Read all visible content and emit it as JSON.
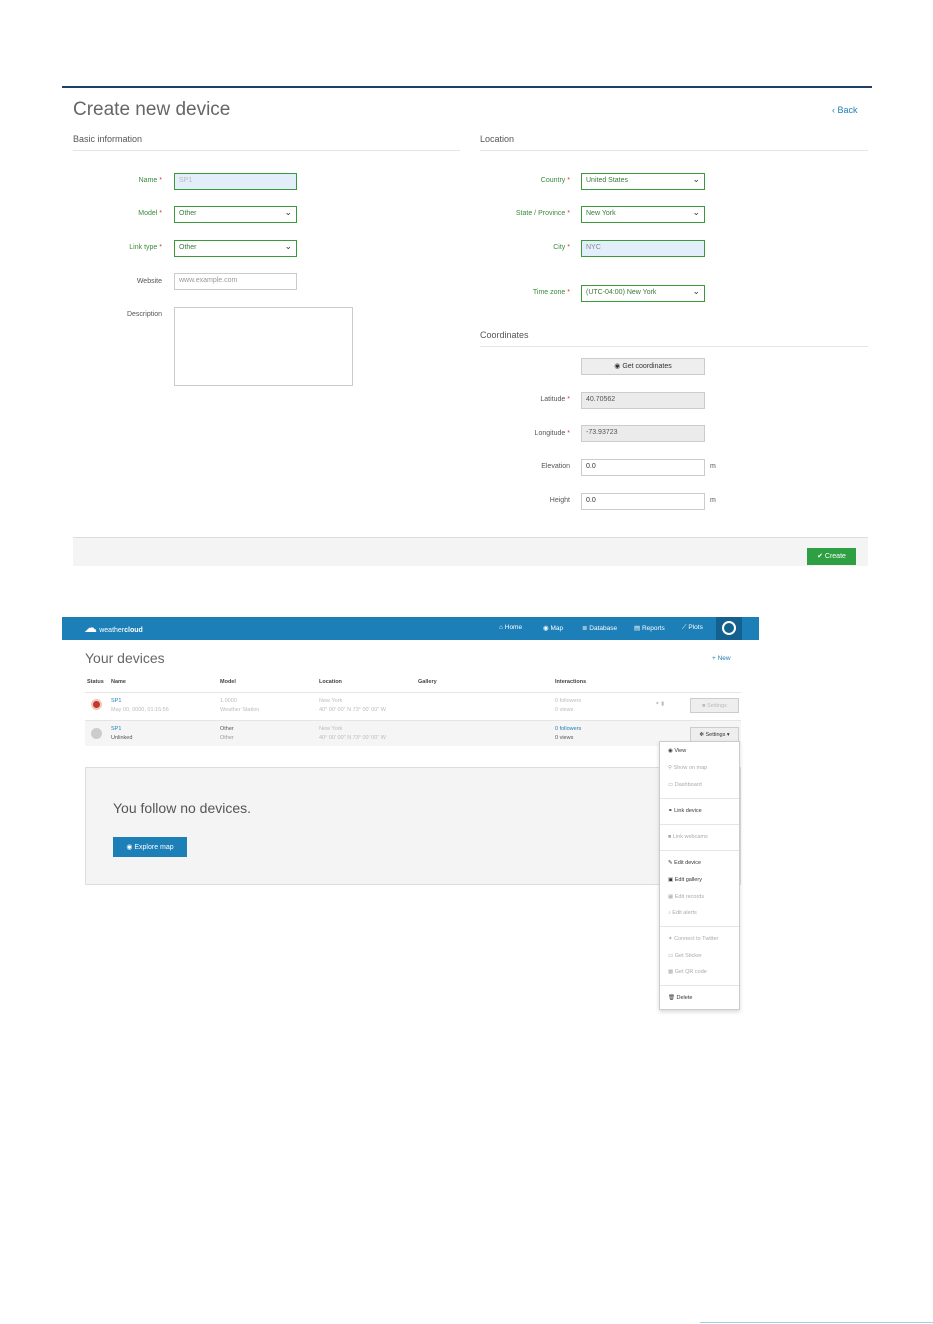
{
  "form": {
    "title": "Create new device",
    "back": "‹ Back",
    "basic_section": "Basic information",
    "location_section": "Location",
    "coordinates_section": "Coordinates",
    "name": {
      "label": "Name",
      "value": "SP1"
    },
    "model": {
      "label": "Model",
      "value": "Other"
    },
    "link_type": {
      "label": "Link type",
      "value": "Other"
    },
    "website": {
      "label": "Website",
      "placeholder": "www.example.com"
    },
    "description": {
      "label": "Description"
    },
    "country": {
      "label": "Country",
      "value": "United States"
    },
    "state": {
      "label": "State / Province",
      "value": "New York"
    },
    "city": {
      "label": "City",
      "value": "NYC"
    },
    "timezone": {
      "label": "Time zone",
      "value": "(UTC-04:00) New York"
    },
    "get_coordinates": "Get coordinates",
    "latitude": {
      "label": "Latitude",
      "value": "40.70562"
    },
    "longitude": {
      "label": "Longitude",
      "value": "-73.93723"
    },
    "elevation": {
      "label": "Elevation",
      "value": "0.0",
      "unit": "m"
    },
    "height": {
      "label": "Height",
      "value": "0.0",
      "unit": "m"
    },
    "create": "Create",
    "required_mark": "*"
  },
  "app": {
    "logo_pre": "weather",
    "logo_bold": "cloud",
    "nav": [
      "Home",
      "Map",
      "Database",
      "Reports",
      "Plots"
    ],
    "devices_title": "Your devices",
    "new_link": "+ New",
    "columns": [
      "Status",
      "Name",
      "Model",
      "Location",
      "Gallery",
      "Interactions"
    ],
    "rows": [
      {
        "name": "SP1",
        "sub": "May 00, 0000, 01:15:56",
        "model": "1.0000",
        "model_sub": "Weather Station",
        "location": "New York",
        "location_sub": "40° 00' 00\" N 73° 00' 00\" W",
        "interactions": "0 followers",
        "views": "0 views",
        "settings": "Settings"
      },
      {
        "name": "SP1",
        "sub": "Unlinked",
        "model": "Other",
        "model_sub": "Other",
        "location": "New York",
        "location_sub": "40° 00' 00\" N 73° 00' 00\" W",
        "interactions": "0 followers",
        "views": "0 views",
        "settings": "Settings ▾"
      }
    ],
    "follow_text": "You follow no devices.",
    "explore": "Explore map",
    "menu": [
      {
        "label": "View",
        "dim": false
      },
      {
        "label": "Show on map",
        "dim": true
      },
      {
        "label": "Dashboard",
        "dim": true
      },
      {
        "label": "Link device",
        "dim": false
      },
      {
        "label": "Link webcams",
        "dim": true
      },
      {
        "label": "Edit device",
        "dim": false
      },
      {
        "label": "Edit gallery",
        "dim": false
      },
      {
        "label": "Edit records",
        "dim": true
      },
      {
        "label": "Edit alerts",
        "dim": true
      },
      {
        "label": "Connect to Twitter",
        "dim": true
      },
      {
        "label": "Get Sticker",
        "dim": true
      },
      {
        "label": "Get QR code",
        "dim": true
      },
      {
        "label": "Delete",
        "dim": false
      }
    ]
  },
  "colors": {
    "accent": "#1d7fb8",
    "green": "#2ea043",
    "label_green": "#3a8a3a"
  }
}
